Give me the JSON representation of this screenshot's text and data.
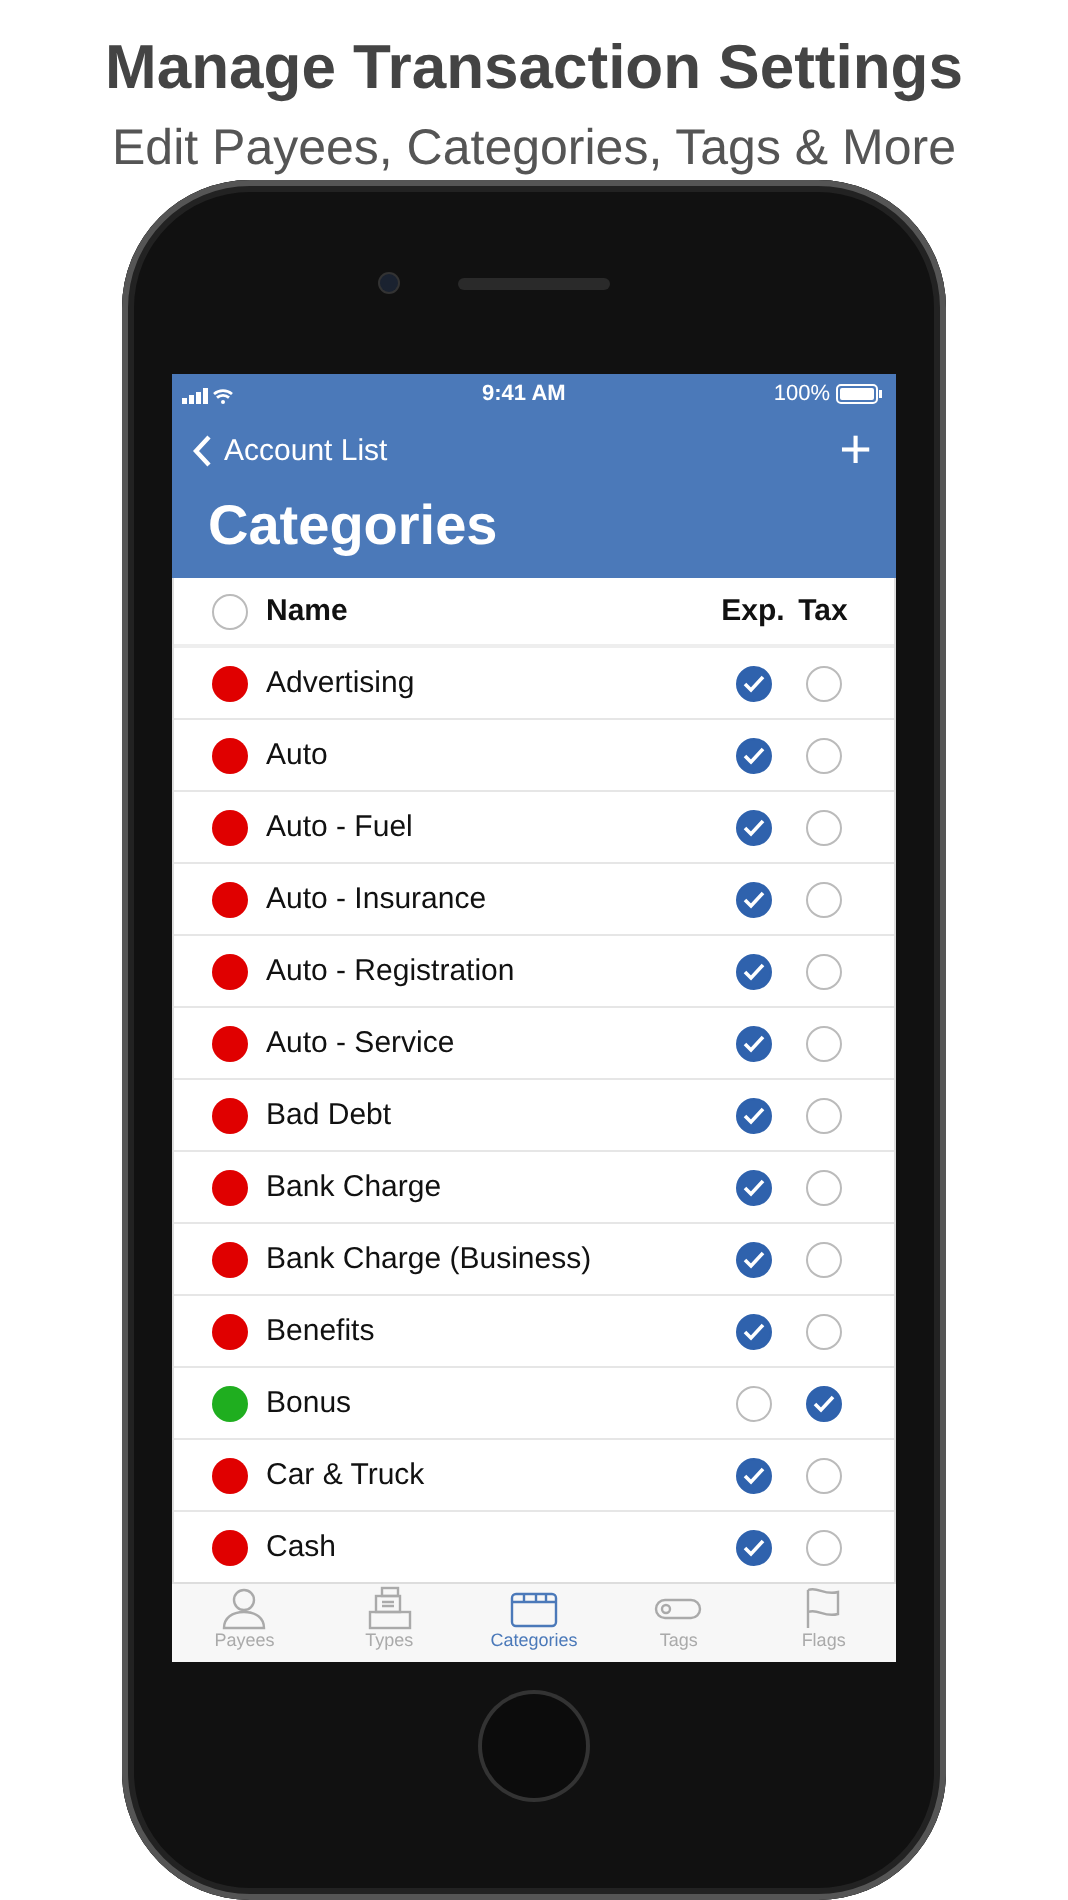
{
  "headline": {
    "title": "Manage Transaction Settings",
    "subtitle": "Edit Payees, Categories, Tags & More"
  },
  "status_bar": {
    "time": "9:41 AM",
    "battery": "100%"
  },
  "nav": {
    "back": "Account List",
    "add": "+",
    "title": "Categories"
  },
  "table": {
    "columns": [
      "Name",
      "Exp.",
      "Tax"
    ],
    "all_checked": false,
    "rows": [
      {
        "name": "Advertising",
        "color": "#e00000",
        "expense": true,
        "tax": false
      },
      {
        "name": "Auto",
        "color": "#e00000",
        "expense": true,
        "tax": false
      },
      {
        "name": "Auto - Fuel",
        "color": "#e00000",
        "expense": true,
        "tax": false
      },
      {
        "name": "Auto - Insurance",
        "color": "#e00000",
        "expense": true,
        "tax": false
      },
      {
        "name": "Auto - Registration",
        "color": "#e00000",
        "expense": true,
        "tax": false
      },
      {
        "name": "Auto - Service",
        "color": "#e00000",
        "expense": true,
        "tax": false
      },
      {
        "name": "Bad Debt",
        "color": "#e00000",
        "expense": true,
        "tax": false
      },
      {
        "name": "Bank Charge",
        "color": "#e00000",
        "expense": true,
        "tax": false
      },
      {
        "name": "Bank Charge (Business)",
        "color": "#e00000",
        "expense": true,
        "tax": false
      },
      {
        "name": "Benefits",
        "color": "#e00000",
        "expense": true,
        "tax": false
      },
      {
        "name": "Bonus",
        "color": "#1fae1f",
        "expense": false,
        "tax": true
      },
      {
        "name": "Car & Truck",
        "color": "#e00000",
        "expense": true,
        "tax": false
      },
      {
        "name": "Cash",
        "color": "#e00000",
        "expense": true,
        "tax": false
      }
    ]
  },
  "tab_bar": [
    {
      "label": "Payees",
      "selected": false
    },
    {
      "label": "Types",
      "selected": false
    },
    {
      "label": "Categories",
      "selected": true
    },
    {
      "label": "Tags",
      "selected": false
    },
    {
      "label": "Flags",
      "selected": false
    }
  ]
}
